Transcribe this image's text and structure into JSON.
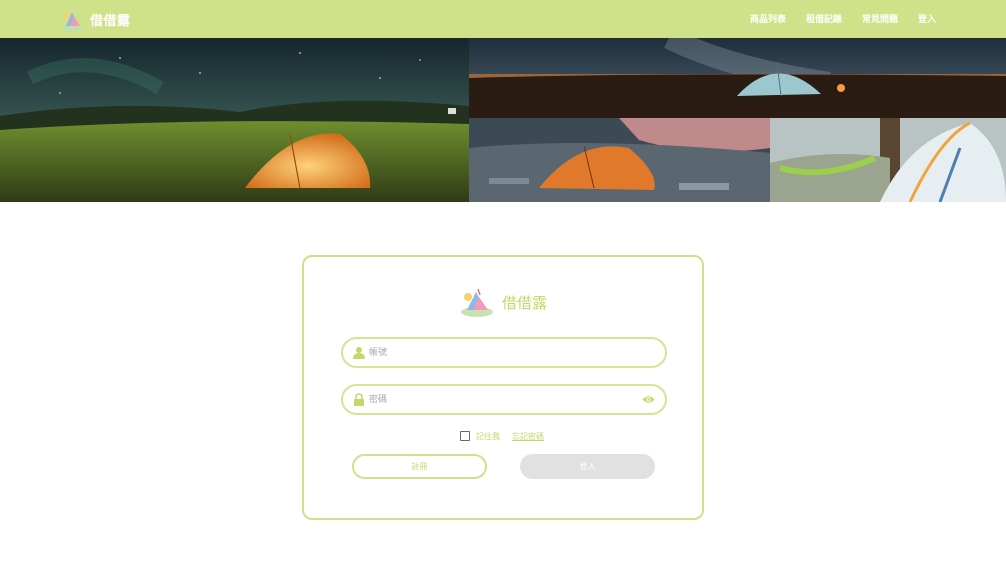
{
  "header": {
    "brand": "借借露",
    "nav": {
      "products": "商品列表",
      "records": "租借記錄",
      "faq": "常見問題",
      "login": "登入"
    }
  },
  "banner": {
    "photos": [
      "night-sky-tent",
      "milky-way-tent",
      "lakeside-tent",
      "hammock-tent"
    ]
  },
  "login_card": {
    "brand": "借借露",
    "account_placeholder": "帳號",
    "password_placeholder": "密碼",
    "remember_label": "記住我",
    "forgot_link": "忘記密碼",
    "register_button": "註冊",
    "login_button": "登入"
  },
  "colors": {
    "accent": "#cfe28a",
    "accent_text": "#c4d86a",
    "disabled": "#e1e1e1"
  },
  "icons": [
    "logo-icon",
    "user-icon",
    "lock-icon",
    "eye-icon"
  ]
}
